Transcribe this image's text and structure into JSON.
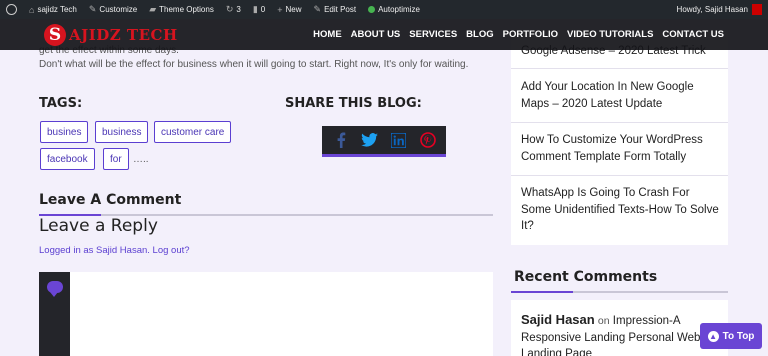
{
  "admin_bar": {
    "site_name": "sajidz Tech",
    "customize": "Customize",
    "theme_options": "Theme Options",
    "updates_count": "3",
    "comments_count": "0",
    "new": "New",
    "edit_post": "Edit Post",
    "autoptimize": "Autoptimize",
    "howdy": "Howdy, Sajid Hasan"
  },
  "header": {
    "logo_mark": "S",
    "logo_text": "AJIDZ TECH",
    "nav": [
      "HOME",
      "ABOUT US",
      "SERVICES",
      "BLOG",
      "PORTFOLIO",
      "VIDEO TUTORIALS",
      "CONTACT US"
    ]
  },
  "post": {
    "excerpt_cut": "get the effect within some days.",
    "excerpt_line": "Don't what will be the effect for business when it will going to start. Right now, It's only for waiting.",
    "tags_title": "TAGS:",
    "tags": [
      "busines",
      "business",
      "customer care",
      "facebook",
      "for"
    ],
    "tags_more": "…..",
    "share_title": "SHARE THIS BLOG:",
    "share_icons": [
      "facebook-icon",
      "twitter-icon",
      "linkedin-icon",
      "pinterest-icon"
    ],
    "leave_comment": "Leave A Comment",
    "reply_title": "Leave a Reply",
    "logged_in": "Logged in as Sajid Hasan. Log out?"
  },
  "sidebar": {
    "recent_posts": [
      "Google Adsense – 2020 Latest Trick",
      "Add Your Location In New Google Maps – 2020 Latest Update",
      "How To Customize Your WordPress Comment Template Form Totally",
      "WhatsApp Is Going To Crash For Some Unidentified Texts-How To Solve It?"
    ],
    "recent_comments_title": "Recent Comments",
    "recent_comment": {
      "author": "Sajid Hasan",
      "on": "on",
      "post": "Impression-A Responsive Landing Personal Website Landing Page"
    }
  },
  "to_top": "To Top",
  "colors": {
    "accent": "#6a45d4",
    "logo_red": "#d7141f",
    "dark": "#24252a",
    "facebook": "#3b5998",
    "twitter": "#1da1f2",
    "linkedin": "#0a66c2",
    "pinterest": "#e60023"
  }
}
